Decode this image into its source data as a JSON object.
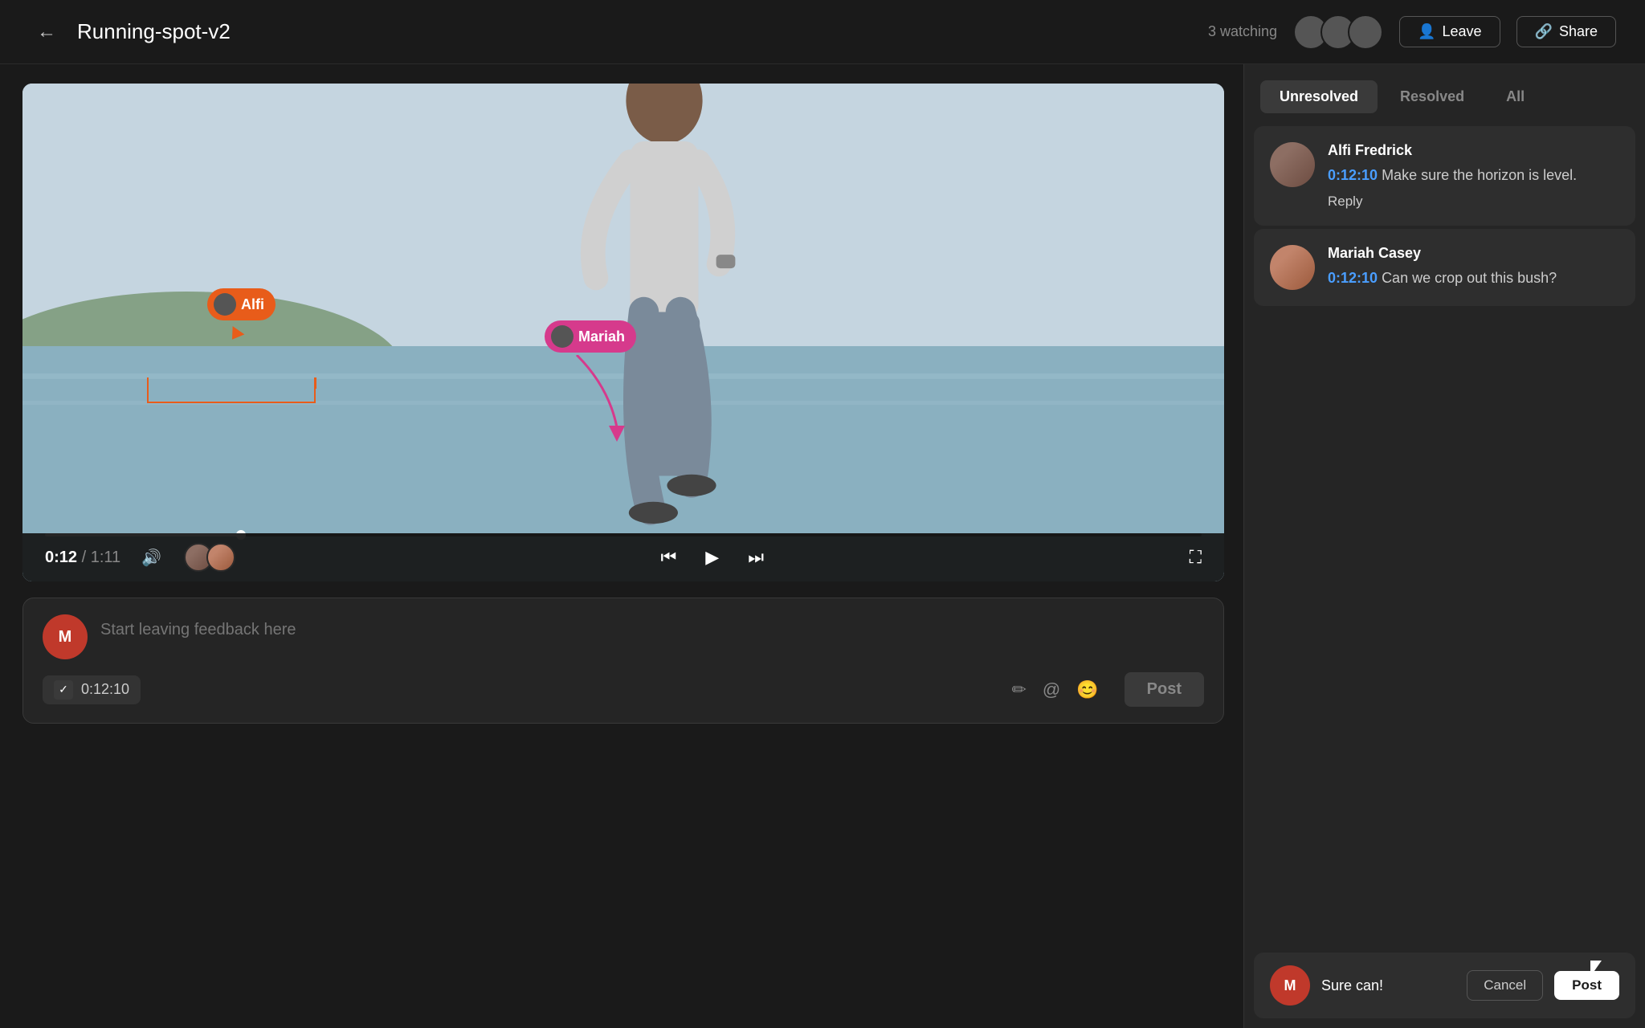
{
  "header": {
    "back_label": "←",
    "title": "Running-spot-v2",
    "watching_label": "3 watching",
    "leave_label": "Leave",
    "share_label": "Share"
  },
  "video": {
    "current_time": "0:12",
    "total_time": "1:11",
    "progress_pct": 17
  },
  "annotations": {
    "alfi_name": "Alfi",
    "mariah_name": "Mariah"
  },
  "feedback": {
    "placeholder": "Start leaving feedback here",
    "timestamp": "0:12:10",
    "post_label": "Post"
  },
  "tabs": {
    "unresolved": "Unresolved",
    "resolved": "Resolved",
    "all": "All"
  },
  "comments": [
    {
      "author": "Alfi Fredrick",
      "timestamp": "0:12:10",
      "text": " Make sure the horizon is level.",
      "reply_label": "Reply"
    },
    {
      "author": "Mariah Casey",
      "timestamp": "0:12:10",
      "text": " Can we crop out this bush?"
    }
  ],
  "reply": {
    "text": "Sure can!",
    "cancel_label": "Cancel",
    "post_label": "Post"
  },
  "icons": {
    "back": "←",
    "leave": "👤",
    "share": "🔗",
    "volume": "🔊",
    "rewind": "⏮",
    "play": "▶",
    "forward": "⏭",
    "fullscreen": "⛶",
    "pen": "✏",
    "at": "@",
    "emoji": "😊",
    "checkmark": "✓"
  }
}
